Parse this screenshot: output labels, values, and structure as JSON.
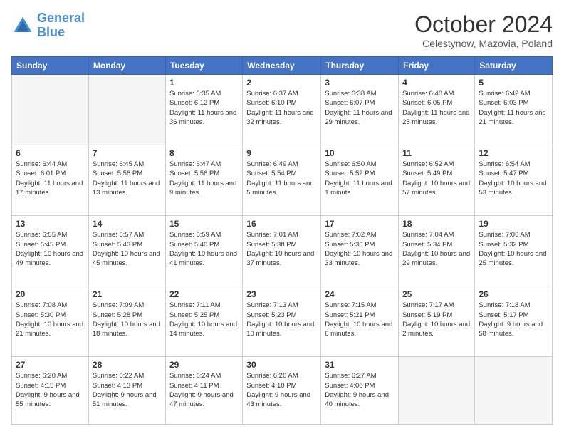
{
  "header": {
    "logo_line1": "General",
    "logo_line2": "Blue",
    "title": "October 2024",
    "subtitle": "Celestynow, Mazovia, Poland"
  },
  "weekdays": [
    "Sunday",
    "Monday",
    "Tuesday",
    "Wednesday",
    "Thursday",
    "Friday",
    "Saturday"
  ],
  "weeks": [
    [
      {
        "day": "",
        "info": ""
      },
      {
        "day": "",
        "info": ""
      },
      {
        "day": "1",
        "info": "Sunrise: 6:35 AM\nSunset: 6:12 PM\nDaylight: 11 hours and 36 minutes."
      },
      {
        "day": "2",
        "info": "Sunrise: 6:37 AM\nSunset: 6:10 PM\nDaylight: 11 hours and 32 minutes."
      },
      {
        "day": "3",
        "info": "Sunrise: 6:38 AM\nSunset: 6:07 PM\nDaylight: 11 hours and 29 minutes."
      },
      {
        "day": "4",
        "info": "Sunrise: 6:40 AM\nSunset: 6:05 PM\nDaylight: 11 hours and 25 minutes."
      },
      {
        "day": "5",
        "info": "Sunrise: 6:42 AM\nSunset: 6:03 PM\nDaylight: 11 hours and 21 minutes."
      }
    ],
    [
      {
        "day": "6",
        "info": "Sunrise: 6:44 AM\nSunset: 6:01 PM\nDaylight: 11 hours and 17 minutes."
      },
      {
        "day": "7",
        "info": "Sunrise: 6:45 AM\nSunset: 5:58 PM\nDaylight: 11 hours and 13 minutes."
      },
      {
        "day": "8",
        "info": "Sunrise: 6:47 AM\nSunset: 5:56 PM\nDaylight: 11 hours and 9 minutes."
      },
      {
        "day": "9",
        "info": "Sunrise: 6:49 AM\nSunset: 5:54 PM\nDaylight: 11 hours and 5 minutes."
      },
      {
        "day": "10",
        "info": "Sunrise: 6:50 AM\nSunset: 5:52 PM\nDaylight: 11 hours and 1 minute."
      },
      {
        "day": "11",
        "info": "Sunrise: 6:52 AM\nSunset: 5:49 PM\nDaylight: 10 hours and 57 minutes."
      },
      {
        "day": "12",
        "info": "Sunrise: 6:54 AM\nSunset: 5:47 PM\nDaylight: 10 hours and 53 minutes."
      }
    ],
    [
      {
        "day": "13",
        "info": "Sunrise: 6:55 AM\nSunset: 5:45 PM\nDaylight: 10 hours and 49 minutes."
      },
      {
        "day": "14",
        "info": "Sunrise: 6:57 AM\nSunset: 5:43 PM\nDaylight: 10 hours and 45 minutes."
      },
      {
        "day": "15",
        "info": "Sunrise: 6:59 AM\nSunset: 5:40 PM\nDaylight: 10 hours and 41 minutes."
      },
      {
        "day": "16",
        "info": "Sunrise: 7:01 AM\nSunset: 5:38 PM\nDaylight: 10 hours and 37 minutes."
      },
      {
        "day": "17",
        "info": "Sunrise: 7:02 AM\nSunset: 5:36 PM\nDaylight: 10 hours and 33 minutes."
      },
      {
        "day": "18",
        "info": "Sunrise: 7:04 AM\nSunset: 5:34 PM\nDaylight: 10 hours and 29 minutes."
      },
      {
        "day": "19",
        "info": "Sunrise: 7:06 AM\nSunset: 5:32 PM\nDaylight: 10 hours and 25 minutes."
      }
    ],
    [
      {
        "day": "20",
        "info": "Sunrise: 7:08 AM\nSunset: 5:30 PM\nDaylight: 10 hours and 21 minutes."
      },
      {
        "day": "21",
        "info": "Sunrise: 7:09 AM\nSunset: 5:28 PM\nDaylight: 10 hours and 18 minutes."
      },
      {
        "day": "22",
        "info": "Sunrise: 7:11 AM\nSunset: 5:25 PM\nDaylight: 10 hours and 14 minutes."
      },
      {
        "day": "23",
        "info": "Sunrise: 7:13 AM\nSunset: 5:23 PM\nDaylight: 10 hours and 10 minutes."
      },
      {
        "day": "24",
        "info": "Sunrise: 7:15 AM\nSunset: 5:21 PM\nDaylight: 10 hours and 6 minutes."
      },
      {
        "day": "25",
        "info": "Sunrise: 7:17 AM\nSunset: 5:19 PM\nDaylight: 10 hours and 2 minutes."
      },
      {
        "day": "26",
        "info": "Sunrise: 7:18 AM\nSunset: 5:17 PM\nDaylight: 9 hours and 58 minutes."
      }
    ],
    [
      {
        "day": "27",
        "info": "Sunrise: 6:20 AM\nSunset: 4:15 PM\nDaylight: 9 hours and 55 minutes."
      },
      {
        "day": "28",
        "info": "Sunrise: 6:22 AM\nSunset: 4:13 PM\nDaylight: 9 hours and 51 minutes."
      },
      {
        "day": "29",
        "info": "Sunrise: 6:24 AM\nSunset: 4:11 PM\nDaylight: 9 hours and 47 minutes."
      },
      {
        "day": "30",
        "info": "Sunrise: 6:26 AM\nSunset: 4:10 PM\nDaylight: 9 hours and 43 minutes."
      },
      {
        "day": "31",
        "info": "Sunrise: 6:27 AM\nSunset: 4:08 PM\nDaylight: 9 hours and 40 minutes."
      },
      {
        "day": "",
        "info": ""
      },
      {
        "day": "",
        "info": ""
      }
    ]
  ]
}
